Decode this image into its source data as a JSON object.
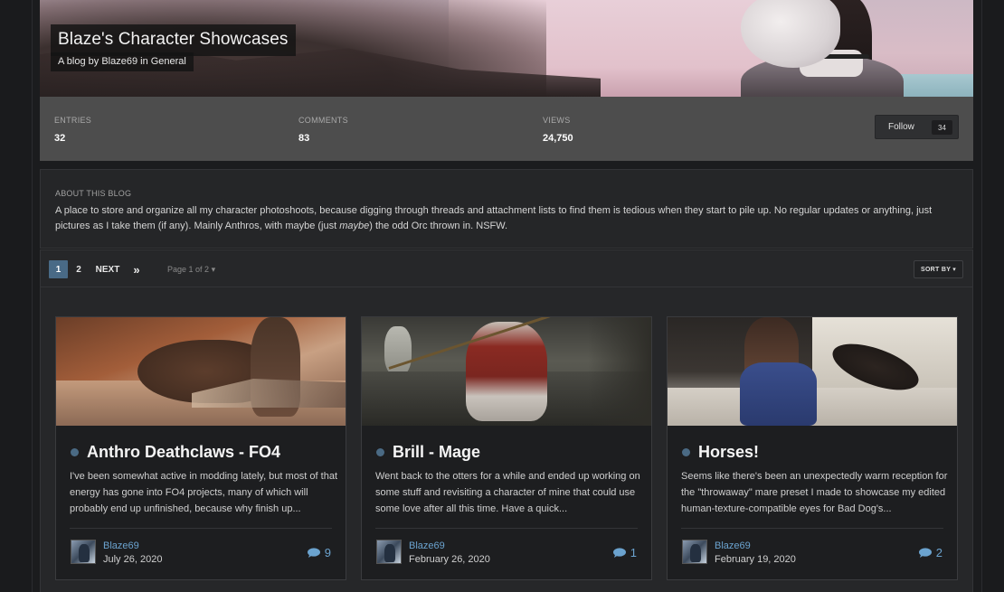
{
  "blog": {
    "title": "Blaze's Character Showcases",
    "subtitle": "A blog by Blaze69 in General"
  },
  "stats": {
    "entries_label": "ENTRIES",
    "entries_value": "32",
    "comments_label": "COMMENTS",
    "comments_value": "83",
    "views_label": "VIEWS",
    "views_value": "24,750"
  },
  "follow": {
    "label": "Follow",
    "count": "34"
  },
  "about": {
    "heading": "ABOUT THIS BLOG",
    "text_before": "A place to store and organize all my character photoshoots, because digging through threads and attachment lists to find them is tedious when they start to pile up. No regular updates or anything, just pictures as I take them (if any). Mainly Anthros, with maybe (just ",
    "text_em": "maybe",
    "text_after": ") the odd Orc thrown in. NSFW."
  },
  "pagination": {
    "pages": [
      "1",
      "2"
    ],
    "active_page": "1",
    "next_label": "NEXT",
    "last_glyph": "»",
    "page_of": "Page 1 of 2",
    "sort_label": "SORT BY"
  },
  "entries": [
    {
      "title": "Anthro Deathclaws - FO4",
      "snippet": "I've been somewhat active in modding lately, but most of that energy has gone into FO4 projects, many of which will probably end up unfinished, because why finish up...",
      "author": "Blaze69",
      "date": "July 26, 2020",
      "comments": "9"
    },
    {
      "title": "Brill - Mage",
      "snippet": "Went back to the otters for a while and ended up working on some stuff and revisiting a character of mine that could use some love after all this time. Have a quick...",
      "author": "Blaze69",
      "date": "February 26, 2020",
      "comments": "1"
    },
    {
      "title": "Horses!",
      "snippet": "Seems like there's been an unexpectedly warm reception for the \"throwaway\" mare preset I made to showcase my edited human-texture-compatible eyes for Bad Dog's...",
      "author": "Blaze69",
      "date": "February 19, 2020",
      "comments": "2"
    }
  ],
  "colors": {
    "accent": "#496a86",
    "link": "#6ba3cf",
    "stats_bar": "#4d4d4d",
    "background": "#1b1c1e"
  },
  "icons": [
    "comment-bubble-icon",
    "caret-down-icon",
    "double-chevron-right-icon"
  ]
}
